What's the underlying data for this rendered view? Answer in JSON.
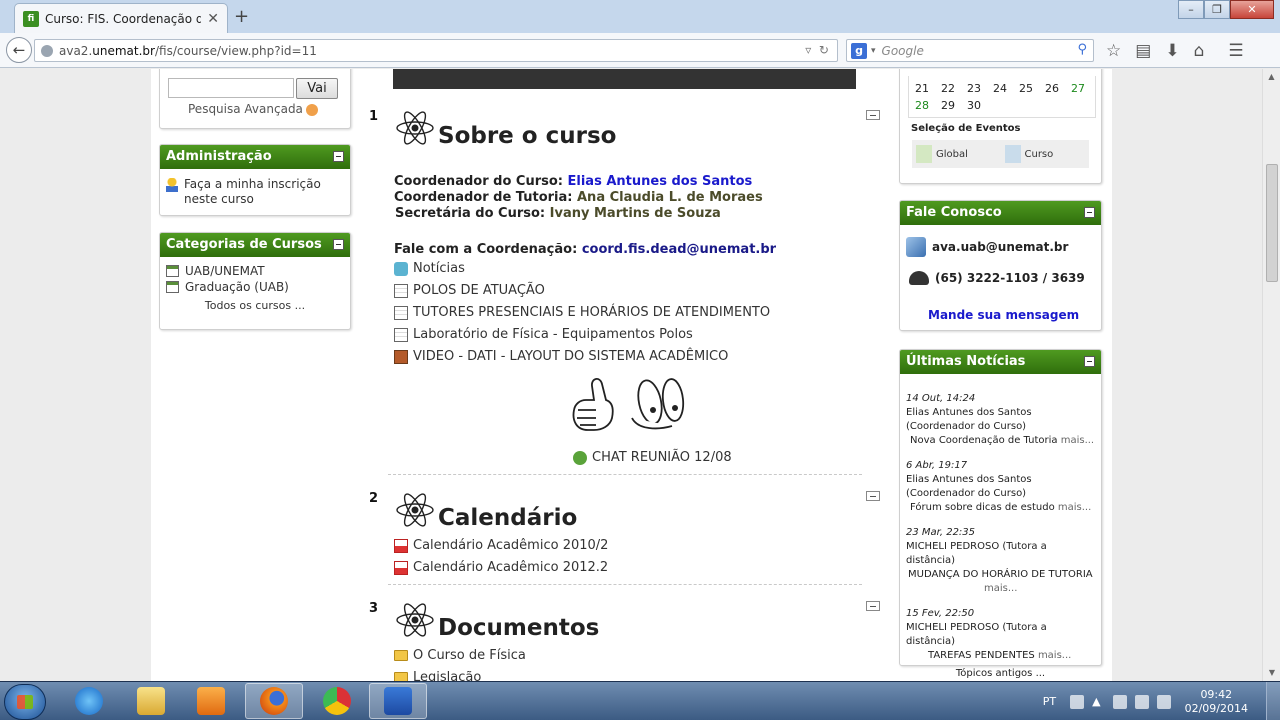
{
  "browser": {
    "tab_title": "Curso: FIS. Coordenação d...",
    "tab_favicon": "fi",
    "url_prefix": "ava2.",
    "url_host": "unemat.br",
    "url_path": "/fis/course/view.php?id=11",
    "search_placeholder": "Google",
    "search_engine_letter": "g"
  },
  "left": {
    "search_button": "Vai",
    "advanced_search": "Pesquisa Avançada",
    "admin": {
      "title": "Administração",
      "enrol_line1": "Faça a minha inscrição",
      "enrol_line2": "neste curso"
    },
    "categories": {
      "title": "Categorias de Cursos",
      "items": [
        "UAB/UNEMAT",
        "Graduação (UAB)"
      ],
      "all": "Todos os cursos ..."
    }
  },
  "sections": [
    {
      "number": "1",
      "title": "Sobre o curso",
      "info": {
        "coord_label": "Coordenador do Curso:",
        "coord_name": "Elias Antunes dos Santos",
        "tutor_label": "Coordenador de Tutoria:",
        "tutor_name": "Ana Claudia L. de Moraes",
        "sec_label": "Secretária do Curso:",
        "sec_name": "Ivany Martins de Souza",
        "contact_label": "Fale com a Coordenação:",
        "contact_email": "coord.fis.dead@unemat.br"
      },
      "activities": [
        "Notícias",
        "POLOS DE ATUAÇÃO",
        "TUTORES PRESENCIAIS E HORÁRIOS DE ATENDIMENTO",
        "Laboratório de Física - Equipamentos Polos",
        "VIDEO - DATI - LAYOUT DO SISTEMA ACADÊMICO"
      ],
      "chat": "CHAT REUNIÃO 12/08"
    },
    {
      "number": "2",
      "title": "Calendário",
      "activities": [
        "Calendário Acadêmico 2010/2",
        "Calendário Acadêmico 2012.2"
      ]
    },
    {
      "number": "3",
      "title": "Documentos",
      "activities": [
        "O Curso de Física",
        "Legislação"
      ]
    }
  ],
  "right": {
    "calendar": {
      "week1": [
        "21",
        "22",
        "23",
        "24",
        "25",
        "26",
        "27"
      ],
      "week2": [
        "28",
        "29",
        "30"
      ],
      "events_title": "Seleção de Eventos",
      "event_global": "Global",
      "event_course": "Curso"
    },
    "contact": {
      "title": "Fale Conosco",
      "email": "ava.uab@unemat.br",
      "phone": "(65) 3222-1103 / 3639",
      "message_link": "Mande sua mensagem"
    },
    "news": {
      "title": "Últimas Notícias",
      "items": [
        {
          "date": "14 Out, 14:24",
          "author": "Elias Antunes dos Santos",
          "role": "(Coordenador do Curso)",
          "subject": "Nova Coordenação de Tutoria",
          "more": "mais..."
        },
        {
          "date": "6 Abr, 19:17",
          "author": "Elias Antunes dos Santos",
          "role": "(Coordenador do Curso)",
          "subject": "Fórum sobre dicas de estudo",
          "more": "mais..."
        },
        {
          "date": "23 Mar, 22:35",
          "author": "MICHELI PEDROSO (Tutora a distância)",
          "role": "",
          "subject": "MUDANÇA DO HORÁRIO DE TUTORIA",
          "more": "mais..."
        },
        {
          "date": "15 Fev, 22:50",
          "author": "MICHELI PEDROSO (Tutora a distância)",
          "role": "",
          "subject": "TAREFAS PENDENTES",
          "more": "mais..."
        }
      ],
      "older": "Tópicos antigos ..."
    }
  },
  "taskbar": {
    "language": "PT",
    "time": "09:42",
    "date": "02/09/2014"
  },
  "colors": {
    "block_header": "#3f8416",
    "link_blue": "#1a1acc",
    "calendar_weekend": "#1d8a1d"
  }
}
